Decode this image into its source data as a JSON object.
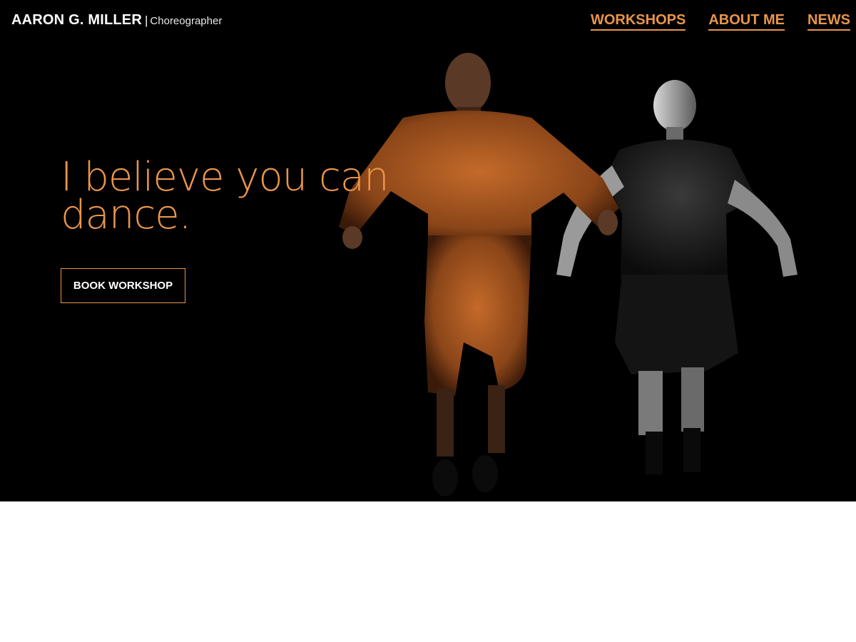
{
  "header": {
    "brand_name": "AARON G. MILLER",
    "brand_separator": "|",
    "brand_role": "Choreographer",
    "nav": [
      {
        "label": "WORKSHOPS"
      },
      {
        "label": "ABOUT ME"
      },
      {
        "label": "NEWS"
      }
    ]
  },
  "hero": {
    "headline": "I believe you can dance.",
    "cta_label": "BOOK WORKSHOP",
    "image": "two-dancers-photo"
  },
  "colors": {
    "accent": "#e9954a",
    "background": "#000000",
    "text": "#ffffff",
    "below_background": "#ffffff"
  }
}
